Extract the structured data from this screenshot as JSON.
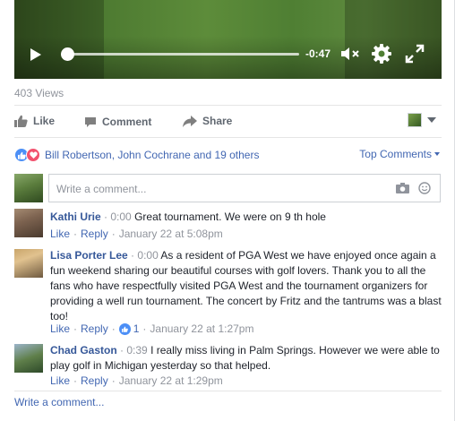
{
  "video": {
    "time_remaining": "-0:47"
  },
  "views": "403 Views",
  "actions": {
    "like": "Like",
    "comment": "Comment",
    "share": "Share"
  },
  "reactions": {
    "names": "Bill Robertson, John Cochrane and 19 others",
    "sort": "Top Comments"
  },
  "composer": {
    "placeholder": "Write a comment..."
  },
  "comments": [
    {
      "name": "Kathi Urie",
      "stamp": "0:00",
      "text": "Great tournament. We were on 9 th hole",
      "like": "Like",
      "reply": "Reply",
      "date": "January 22 at 5:08pm"
    },
    {
      "name": "Lisa Porter Lee",
      "stamp": "0:00",
      "text": "As a resident of PGA West we have enjoyed once again a fun weekend sharing our beautiful courses with golf lovers. Thank you to all the fans who have respectfully visited PGA West and the tournament organizers for providing a well run tournament. The concert by Fritz and the tantrums was a blast too!",
      "like": "Like",
      "reply": "Reply",
      "like_count": "1",
      "date": "January 22 at 1:27pm"
    },
    {
      "name": "Chad Gaston",
      "stamp": "0:39",
      "text": "I really miss living in Palm Springs. However we were able to play golf in Michigan yesterday so that helped.",
      "like": "Like",
      "reply": "Reply",
      "date": "January 22 at 1:29pm"
    }
  ],
  "write_comment": "Write a comment...",
  "colors": {
    "link": "#4267b2",
    "name": "#365899",
    "muted": "#90949c",
    "like_badge": "#4c8ff6",
    "love_badge": "#f2526e"
  }
}
